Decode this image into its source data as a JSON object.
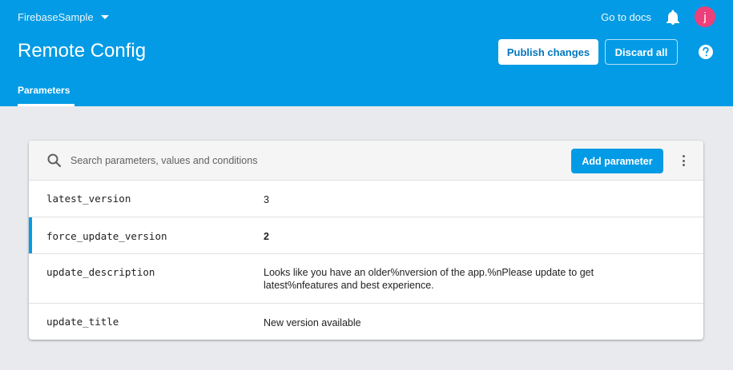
{
  "header": {
    "project_name": "FirebaseSample",
    "docs_link": "Go to docs",
    "avatar_initial": "j",
    "page_title": "Remote Config",
    "publish_label": "Publish changes",
    "discard_label": "Discard all",
    "tabs": [
      {
        "label": "Parameters"
      }
    ]
  },
  "toolbar": {
    "search_placeholder": "Search parameters, values and conditions",
    "add_label": "Add parameter"
  },
  "parameters": [
    {
      "key": "latest_version",
      "value": "3",
      "selected": false
    },
    {
      "key": "force_update_version",
      "value": "2",
      "selected": true
    },
    {
      "key": "update_description",
      "value": "Looks like you have an older%nversion of the app.%nPlease update to get latest%nfeatures and best experience.",
      "selected": false
    },
    {
      "key": "update_title",
      "value": "New version available",
      "selected": false
    }
  ],
  "colors": {
    "header_bg": "#039be5",
    "avatar_bg": "#ec407a",
    "page_bg": "#e8eaed"
  }
}
